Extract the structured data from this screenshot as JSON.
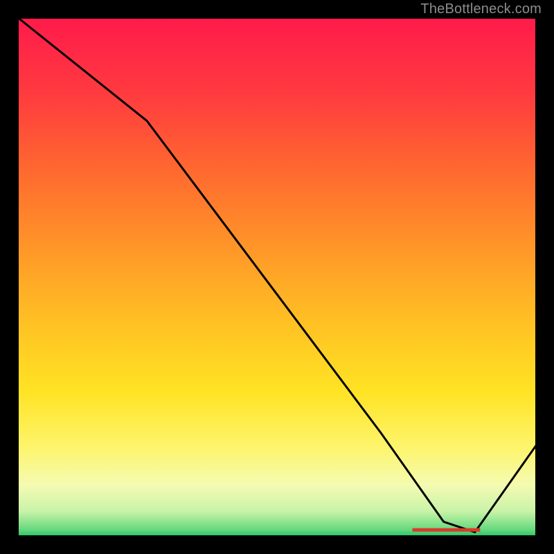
{
  "attribution": "TheBottleneck.com",
  "chart_data": {
    "type": "line",
    "title": "",
    "xlabel": "",
    "ylabel": "",
    "xlim": [
      0,
      100
    ],
    "ylim": [
      0,
      100
    ],
    "x": [
      0,
      10,
      25,
      40,
      55,
      70,
      82,
      88,
      100
    ],
    "values": [
      100,
      92,
      80,
      60,
      40,
      20,
      3,
      1,
      18
    ],
    "min_marker": {
      "x_start": 76,
      "x_end": 89,
      "y": 1.5
    },
    "background_gradient": [
      {
        "offset": 0.0,
        "color": "#ff1a4b"
      },
      {
        "offset": 0.15,
        "color": "#ff3b3f"
      },
      {
        "offset": 0.3,
        "color": "#ff6a2f"
      },
      {
        "offset": 0.45,
        "color": "#ff9828"
      },
      {
        "offset": 0.6,
        "color": "#ffc423"
      },
      {
        "offset": 0.72,
        "color": "#ffe324"
      },
      {
        "offset": 0.83,
        "color": "#fdf56e"
      },
      {
        "offset": 0.9,
        "color": "#f4fbb2"
      },
      {
        "offset": 0.95,
        "color": "#c8f3a8"
      },
      {
        "offset": 0.985,
        "color": "#66d97e"
      },
      {
        "offset": 1.0,
        "color": "#1fbf63"
      }
    ],
    "line_color": "#000000",
    "frame_color": "#000000",
    "min_marker_color": "#d83a2a"
  }
}
